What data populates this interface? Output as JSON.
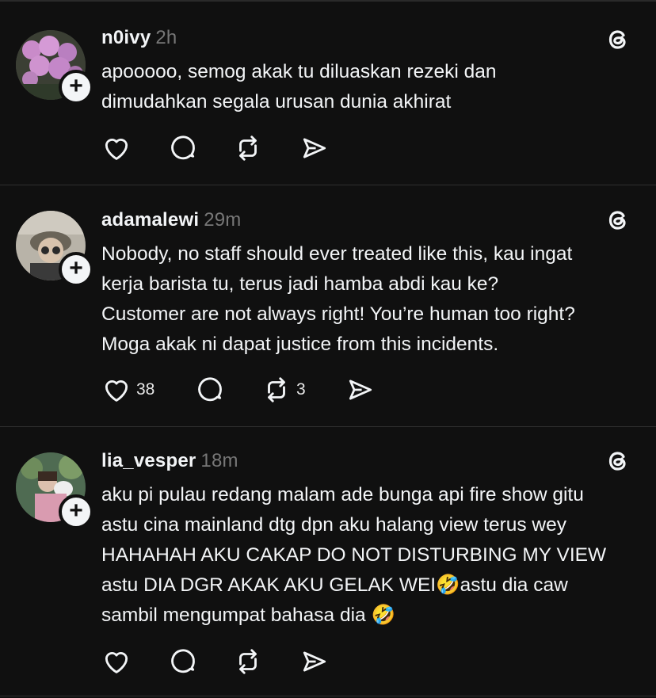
{
  "posts": [
    {
      "username": "n0ivy",
      "time": "2h",
      "text": "apooooo, semog akak tu diluaskan rezeki dan\ndimudahkan segala urusan dunia akhirat",
      "likes": "",
      "reposts": "",
      "avatar_desc": "pink-flowers-avatar"
    },
    {
      "username": "adamalewi",
      "time": "29m",
      "text": "Nobody, no staff should ever treated like this, kau ingat\nkerja barista tu, terus jadi hamba abdi kau ke?\nCustomer are not always right! You’re human too right?\nMoga akak ni dapat justice from this incidents.",
      "likes": "38",
      "reposts": "3",
      "avatar_desc": "person-avatar"
    },
    {
      "username": "lia_vesper",
      "time": "18m",
      "text": "aku pi pulau redang malam ade bunga api fire show gitu\nastu cina mainland dtg dpn aku halang view terus wey\nHAHAHAH AKU CAKAP DO NOT DISTURBING MY VIEW\nastu DIA DGR AKAK AKU GELAK WEI🤣astu dia caw\nsambil mengumpat bahasa dia 🤣",
      "likes": "",
      "reposts": "",
      "avatar_desc": "person-avatar"
    }
  ],
  "icons": {
    "follow": "+",
    "like": "heart-icon",
    "reply": "comment-icon",
    "repost": "repost-icon",
    "share": "share-icon",
    "brand": "threads-logo-icon"
  },
  "colors": {
    "background": "#101010",
    "text": "#f3f5f7",
    "muted": "#777777"
  }
}
